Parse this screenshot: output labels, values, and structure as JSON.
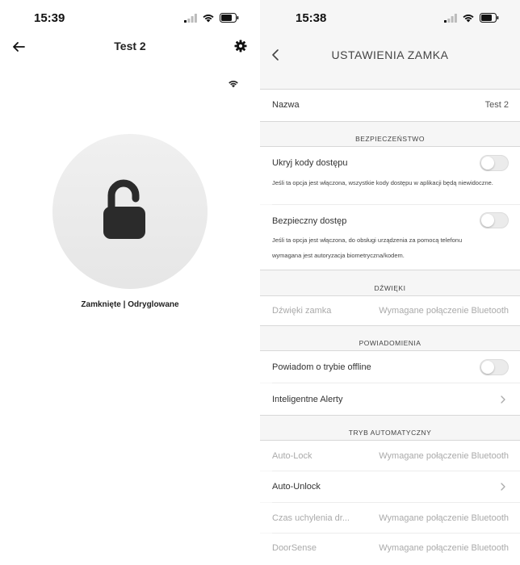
{
  "left": {
    "status_time": "15:39",
    "header_title": "Test 2",
    "lock_status": "Zamknięte | Odryglowane"
  },
  "right": {
    "status_time": "15:38",
    "header_title": "USTAWIENIA ZAMKA",
    "name_label": "Nazwa",
    "name_value": "Test 2",
    "sections": {
      "security": "BEZPIECZEŃSTWO",
      "sounds": "DŹWIĘKI",
      "notifications": "POWIADOMIENIA",
      "auto_mode": "TRYB AUTOMATYCZNY"
    },
    "hide_codes": {
      "label": "Ukryj kody dostępu",
      "desc": "Jeśli ta opcja jest włączona, wszystkie kody dostępu w aplikacji będą niewidoczne.",
      "enabled": false
    },
    "secure_access": {
      "label": "Bezpieczny dostęp",
      "desc_1": "Jeśli ta opcja jest włączona, do obsługi urządzenia za pomocą telefonu",
      "desc_2": "wymagana jest autoryzacja biometryczna/kodem.",
      "enabled": false
    },
    "lock_sounds": {
      "label": "Dźwięki zamka",
      "value": "Wymagane połączenie Bluetooth"
    },
    "offline_notify": {
      "label": "Powiadom o trybie offline",
      "enabled": false
    },
    "smart_alerts": {
      "label": "Inteligentne Alerty"
    },
    "auto_lock": {
      "label": "Auto-Lock",
      "value": "Wymagane połączenie Bluetooth"
    },
    "auto_unlock": {
      "label": "Auto-Unlock"
    },
    "door_ajar_time": {
      "label": "Czas uchylenia dr...",
      "value": "Wymagane połączenie Bluetooth"
    },
    "door_sense": {
      "label": "DoorSense",
      "value": "Wymagane połączenie Bluetooth"
    }
  }
}
